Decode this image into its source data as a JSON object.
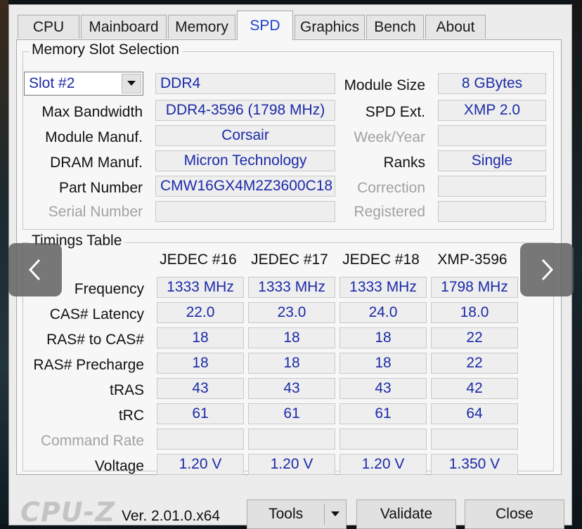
{
  "tabs": [
    "CPU",
    "Mainboard",
    "Memory",
    "SPD",
    "Graphics",
    "Bench",
    "About"
  ],
  "active_tab": "SPD",
  "slot_group": {
    "title": "Memory Slot Selection",
    "slot_selected": "Slot #2",
    "memory_type": "DDR4",
    "module_size_label": "Module Size",
    "module_size": "8 GBytes",
    "max_bandwidth_label": "Max Bandwidth",
    "max_bandwidth": "DDR4-3596 (1798 MHz)",
    "spd_ext_label": "SPD Ext.",
    "spd_ext": "XMP 2.0",
    "module_manuf_label": "Module Manuf.",
    "module_manuf": "Corsair",
    "week_year_label": "Week/Year",
    "week_year": "",
    "dram_manuf_label": "DRAM Manuf.",
    "dram_manuf": "Micron Technology",
    "ranks_label": "Ranks",
    "ranks": "Single",
    "part_number_label": "Part Number",
    "part_number": "CMW16GX4M2Z3600C18",
    "correction_label": "Correction",
    "correction": "",
    "serial_number_label": "Serial Number",
    "serial_number": "",
    "registered_label": "Registered",
    "registered": ""
  },
  "timings": {
    "title": "Timings Table",
    "columns": [
      "JEDEC #16",
      "JEDEC #17",
      "JEDEC #18",
      "XMP-3596"
    ],
    "rows": [
      {
        "label": "Frequency",
        "disabled": false,
        "values": [
          "1333 MHz",
          "1333 MHz",
          "1333 MHz",
          "1798 MHz"
        ]
      },
      {
        "label": "CAS# Latency",
        "disabled": false,
        "values": [
          "22.0",
          "23.0",
          "24.0",
          "18.0"
        ]
      },
      {
        "label": "RAS# to CAS#",
        "disabled": false,
        "values": [
          "18",
          "18",
          "18",
          "22"
        ]
      },
      {
        "label": "RAS# Precharge",
        "disabled": false,
        "values": [
          "18",
          "18",
          "18",
          "22"
        ]
      },
      {
        "label": "tRAS",
        "disabled": false,
        "values": [
          "43",
          "43",
          "43",
          "42"
        ]
      },
      {
        "label": "tRC",
        "disabled": false,
        "values": [
          "61",
          "61",
          "61",
          "64"
        ]
      },
      {
        "label": "Command Rate",
        "disabled": true,
        "values": [
          "",
          "",
          "",
          ""
        ]
      },
      {
        "label": "Voltage",
        "disabled": false,
        "values": [
          "1.20 V",
          "1.20 V",
          "1.20 V",
          "1.350 V"
        ]
      }
    ]
  },
  "footer": {
    "logo": "CPU-Z",
    "version": "Ver. 2.01.0.x64",
    "tools_label": "Tools",
    "validate_label": "Validate",
    "close_label": "Close"
  },
  "icons": {
    "dropdown": "chevron-down-icon",
    "prev": "chevron-left-icon",
    "next": "chevron-right-icon"
  },
  "colors": {
    "value_text": "#1b2aa8",
    "active_tab_text": "#1e3fd0"
  }
}
